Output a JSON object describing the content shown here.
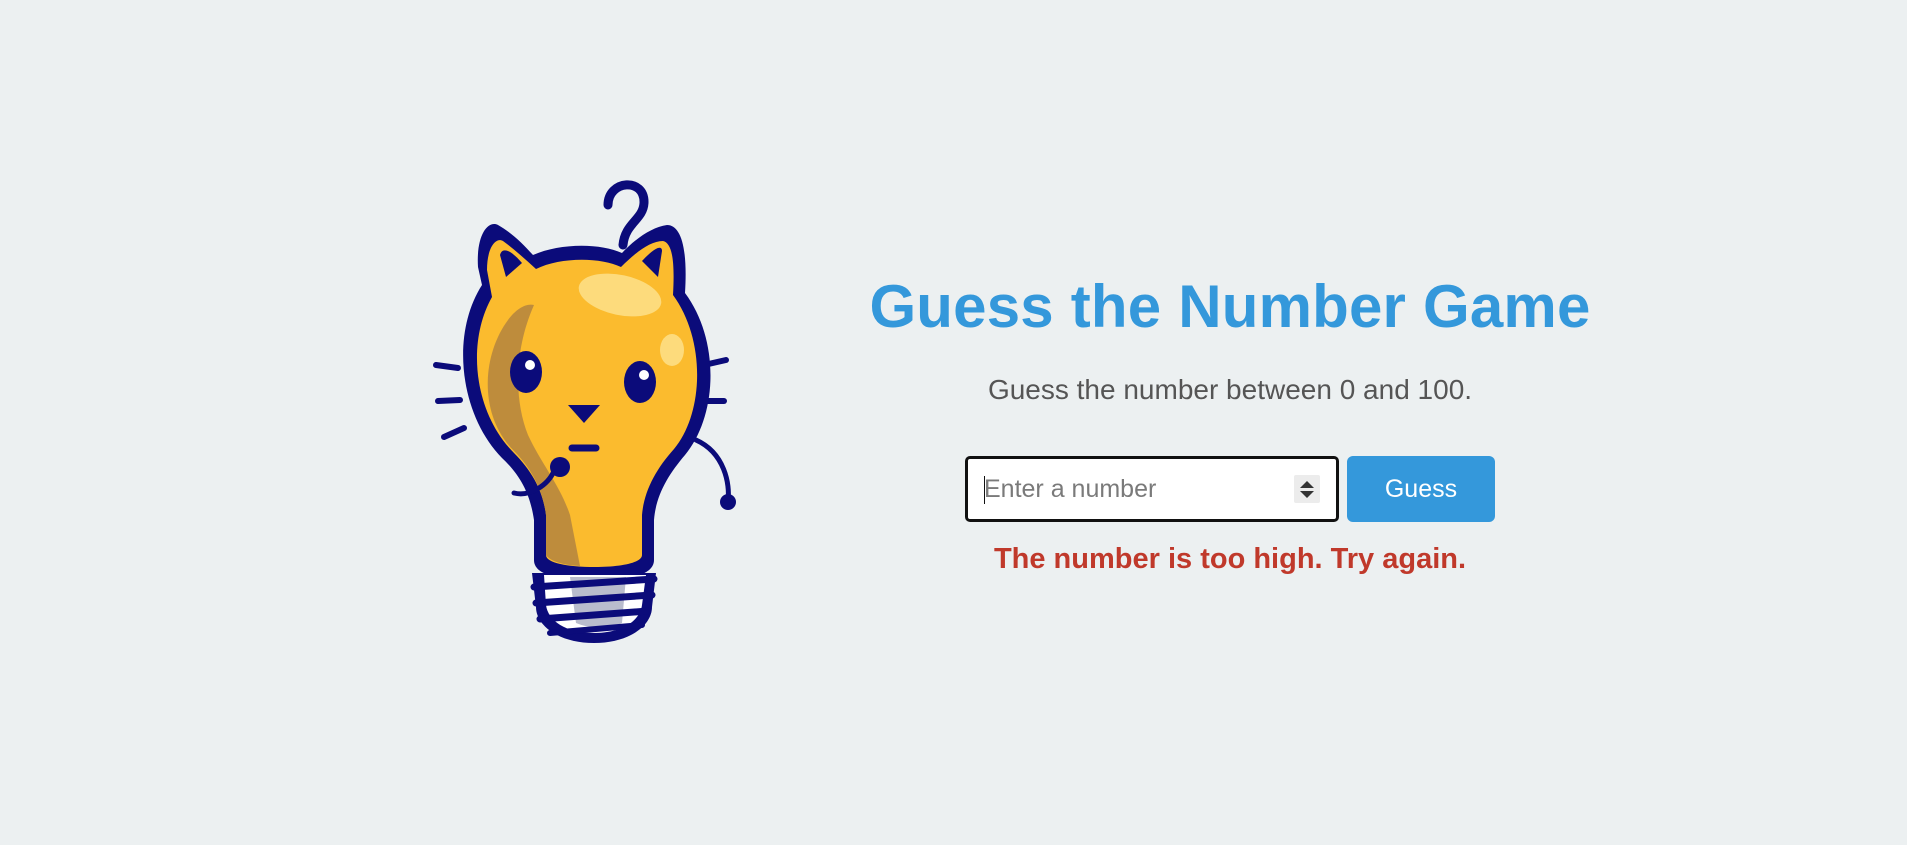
{
  "illustration": {
    "icon": "lightbulb-cat-icon",
    "colors": {
      "outline": "#0b0b7a",
      "bulb": "#fbbb2e",
      "shade": "#b7873e",
      "highlight": "#fde08a",
      "base": "#b9bccd"
    }
  },
  "game": {
    "title": "Guess the Number Game",
    "instructions": "Guess the number between 0 and 100.",
    "input": {
      "placeholder": "Enter a number",
      "value": ""
    },
    "guess_label": "Guess",
    "feedback": "The number is too high. Try again."
  },
  "colors": {
    "background": "#ecf0f1",
    "accent": "#3498db",
    "error": "#c0392b",
    "text": "#555555"
  }
}
